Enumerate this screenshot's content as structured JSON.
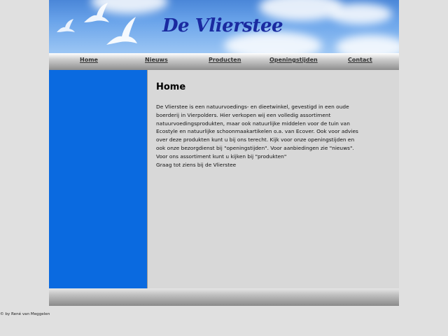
{
  "header": {
    "title": "De Vlierstee"
  },
  "nav": {
    "items": [
      {
        "label": "Home"
      },
      {
        "label": "Nieuws"
      },
      {
        "label": "Producten"
      },
      {
        "label": "Openingstijden"
      },
      {
        "label": "Contact"
      }
    ]
  },
  "main": {
    "title": "Home",
    "lines": [
      "De Vlierstee is een natuurvoedings- en dieetwinkel, gevestigd in een oude",
      "boerderij in Vierpolders. Hier verkopen wij een volledig assortiment",
      "natuurvoedingsprodukten, maar ook natuurlijke middelen voor de tuin van",
      "Ecostyle en natuurlijke schoonmaakartikelen o.a. van Ecover. Ook voor advies",
      "over deze produkten kunt u bij ons terecht. Kijk voor onze openingstijden en",
      "ook onze bezorgdienst bij \"openingstijden\". Voor aanbiedingen zie \"nieuws\".",
      "Voor ons assortiment kunt u kijken bij \"produkten\"",
      "Graag tot ziens bij de Vlierstee"
    ]
  },
  "footer": {
    "copyright": "© by René van Meggelen"
  },
  "colors": {
    "sidebar": "#0a6ae0",
    "title": "#1a2aa0",
    "background": "#e0e0e0"
  }
}
